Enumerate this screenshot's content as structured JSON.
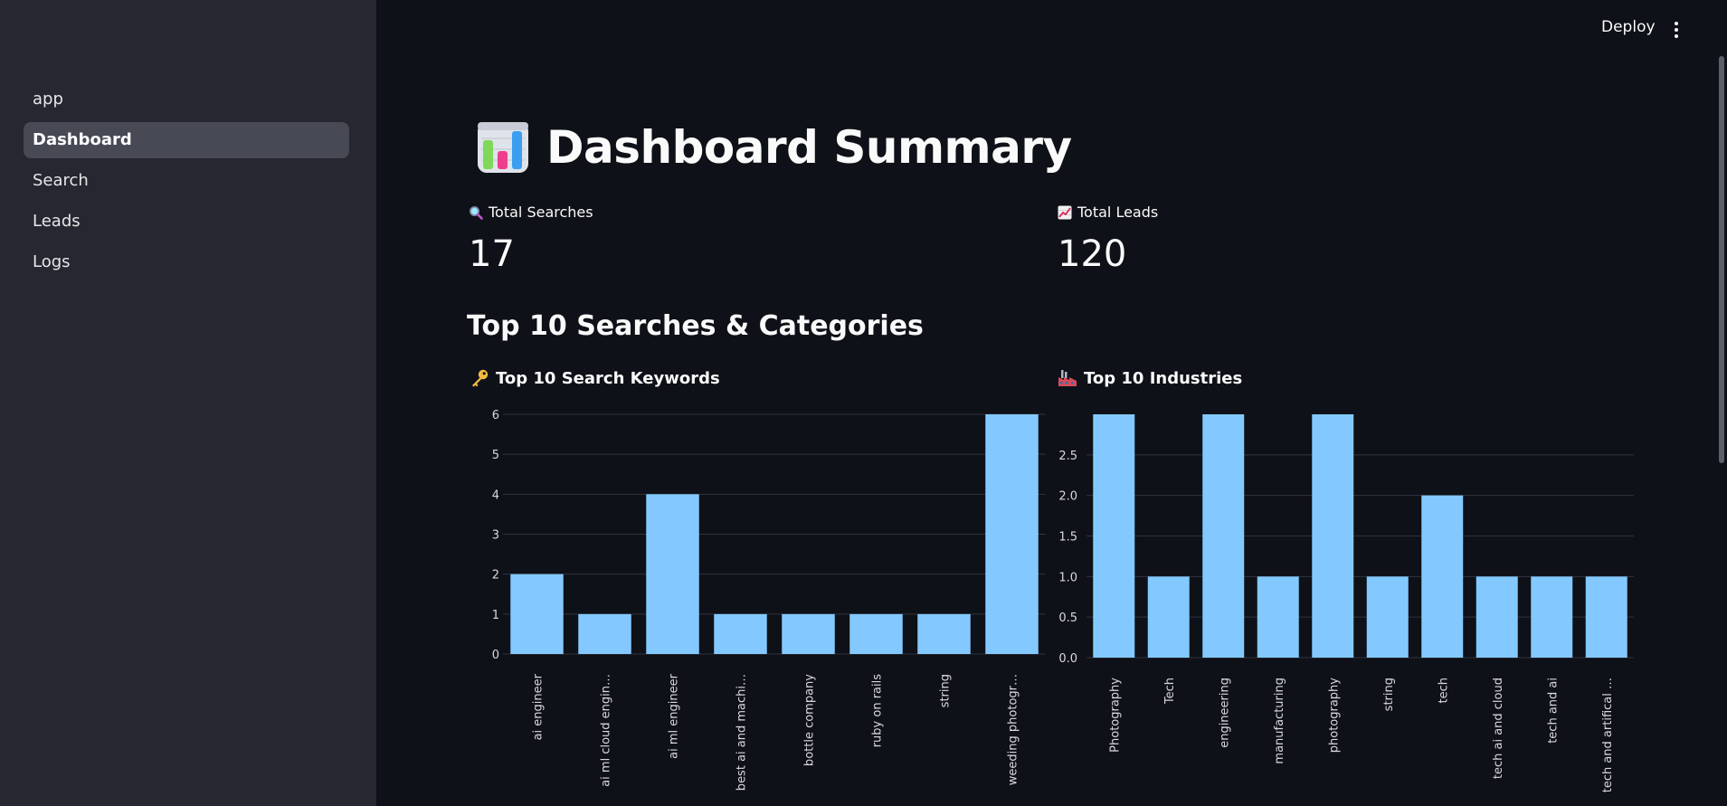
{
  "sidebar": {
    "items": [
      {
        "label": "app",
        "active": false
      },
      {
        "label": "Dashboard",
        "active": true
      },
      {
        "label": "Search",
        "active": false
      },
      {
        "label": "Leads",
        "active": false
      },
      {
        "label": "Logs",
        "active": false
      }
    ]
  },
  "header": {
    "deploy_label": "Deploy",
    "menu_icon": "kebab-menu-icon"
  },
  "page": {
    "title_icon": "bar-chart-emoji-icon",
    "title": "Dashboard Summary",
    "metrics": {
      "total_searches": {
        "icon": "magnifier-icon",
        "label": "Total Searches",
        "value": "17"
      },
      "total_leads": {
        "icon": "chart-increasing-icon",
        "label": "Total Leads",
        "value": "120"
      }
    },
    "section_heading": "Top 10 Searches & Categories",
    "keywords_chart": {
      "icon": "key-icon",
      "title": "Top 10 Search Keywords"
    },
    "industries_chart": {
      "icon": "factory-icon",
      "title": "Top 10 Industries"
    }
  },
  "colors": {
    "bar": "#83c9ff",
    "grid": "#31333f",
    "background": "#0e1117",
    "sidebar": "#262730"
  },
  "chart_data": [
    {
      "type": "bar",
      "title": "Top 10 Search Keywords",
      "categories": [
        "ai engineer",
        "ai ml cloud engin…",
        "ai ml engineer",
        "best ai and machi…",
        "bottle company",
        "ruby on rails",
        "string",
        "weeding photogr…"
      ],
      "values": [
        2,
        1,
        4,
        1,
        1,
        1,
        1,
        6
      ],
      "ylim": [
        0,
        6
      ],
      "yticks": [
        "0",
        "1",
        "2",
        "3",
        "4",
        "5",
        "6"
      ],
      "grid": true
    },
    {
      "type": "bar",
      "title": "Top 10 Industries",
      "categories": [
        "Photography",
        "Tech",
        "engineering",
        "manufacturing",
        "photography",
        "string",
        "tech",
        "tech ai and cloud",
        "tech and ai",
        "tech and artifical …"
      ],
      "values": [
        3,
        1,
        3,
        1,
        3,
        1,
        2,
        1,
        1,
        1
      ],
      "ylim": [
        0,
        3
      ],
      "yticks": [
        "0.0",
        "0.5",
        "1.0",
        "1.5",
        "2.0",
        "2.5"
      ],
      "grid": true
    }
  ]
}
